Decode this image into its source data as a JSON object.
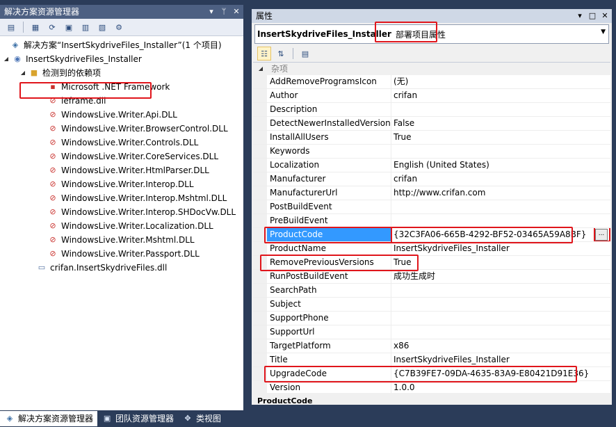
{
  "solution_explorer": {
    "title": "解决方案资源管理器",
    "title_buttons": [
      "▾",
      "ᛘ",
      "✕"
    ],
    "toolbar_icons": [
      "properties-icon",
      "show-all-files-icon",
      "refresh-icon",
      "file-system-editor-icon",
      "registry-editor-icon",
      "file-types-editor-icon",
      "custom-actions-editor-icon"
    ],
    "tree": {
      "solution": "解决方案“InsertSkydriveFiles_Installer”(1 个项目)",
      "project": "InsertSkydriveFiles_Installer",
      "deps_folder": "检测到的依赖项",
      "dependencies": [
        "Microsoft .NET Framework",
        "ieframe.dll",
        "WindowsLive.Writer.Api.DLL",
        "WindowsLive.Writer.BrowserControl.DLL",
        "WindowsLive.Writer.Controls.DLL",
        "WindowsLive.Writer.CoreServices.DLL",
        "WindowsLive.Writer.HtmlParser.DLL",
        "WindowsLive.Writer.Interop.DLL",
        "WindowsLive.Writer.Interop.Mshtml.DLL",
        "WindowsLive.Writer.Interop.SHDocVw.DLL",
        "WindowsLive.Writer.Localization.DLL",
        "WindowsLive.Writer.Mshtml.DLL",
        "WindowsLive.Writer.Passport.DLL"
      ],
      "output": "crifan.InsertSkydriveFiles.dll"
    }
  },
  "bottom_tabs": [
    {
      "label": "解决方案资源管理器",
      "icon": "solution-explorer-icon",
      "active": true
    },
    {
      "label": "团队资源管理器",
      "icon": "team-explorer-icon",
      "active": false
    },
    {
      "label": "类视图",
      "icon": "class-view-icon",
      "active": false
    }
  ],
  "properties": {
    "title": "属性",
    "title_buttons": [
      "▾",
      "□",
      "✕"
    ],
    "object_name": "InsertSkydriveFiles_Installer",
    "object_type": "部署项目属性",
    "category": "杂项",
    "rows": [
      {
        "name": "AddRemoveProgramsIcon",
        "value": "(无)"
      },
      {
        "name": "Author",
        "value": "crifan"
      },
      {
        "name": "Description",
        "value": ""
      },
      {
        "name": "DetectNewerInstalledVersion",
        "value": "False"
      },
      {
        "name": "InstallAllUsers",
        "value": "True"
      },
      {
        "name": "Keywords",
        "value": ""
      },
      {
        "name": "Localization",
        "value": "English (United States)"
      },
      {
        "name": "Manufacturer",
        "value": "crifan"
      },
      {
        "name": "ManufacturerUrl",
        "value": "http://www.crifan.com"
      },
      {
        "name": "PostBuildEvent",
        "value": ""
      },
      {
        "name": "PreBuildEvent",
        "value": ""
      },
      {
        "name": "ProductCode",
        "value": "{32C3FA06-665B-4292-BF52-03465A59A8BF}",
        "selected": true
      },
      {
        "name": "ProductName",
        "value": "InsertSkydriveFiles_Installer"
      },
      {
        "name": "RemovePreviousVersions",
        "value": "True"
      },
      {
        "name": "RunPostBuildEvent",
        "value": "成功生成时"
      },
      {
        "name": "SearchPath",
        "value": ""
      },
      {
        "name": "Subject",
        "value": ""
      },
      {
        "name": "SupportPhone",
        "value": ""
      },
      {
        "name": "SupportUrl",
        "value": ""
      },
      {
        "name": "TargetPlatform",
        "value": "x86"
      },
      {
        "name": "Title",
        "value": "InsertSkydriveFiles_Installer"
      },
      {
        "name": "UpgradeCode",
        "value": "{C7B39FE7-09DA-4635-83A9-E80421D91E36}"
      },
      {
        "name": "Version",
        "value": "1.0.0"
      }
    ],
    "ellipsis_label": "...",
    "description_title": "ProductCode"
  },
  "colors": {
    "highlight": "#e0151b",
    "selection": "#3399ff",
    "frame": "#2b3c59"
  }
}
